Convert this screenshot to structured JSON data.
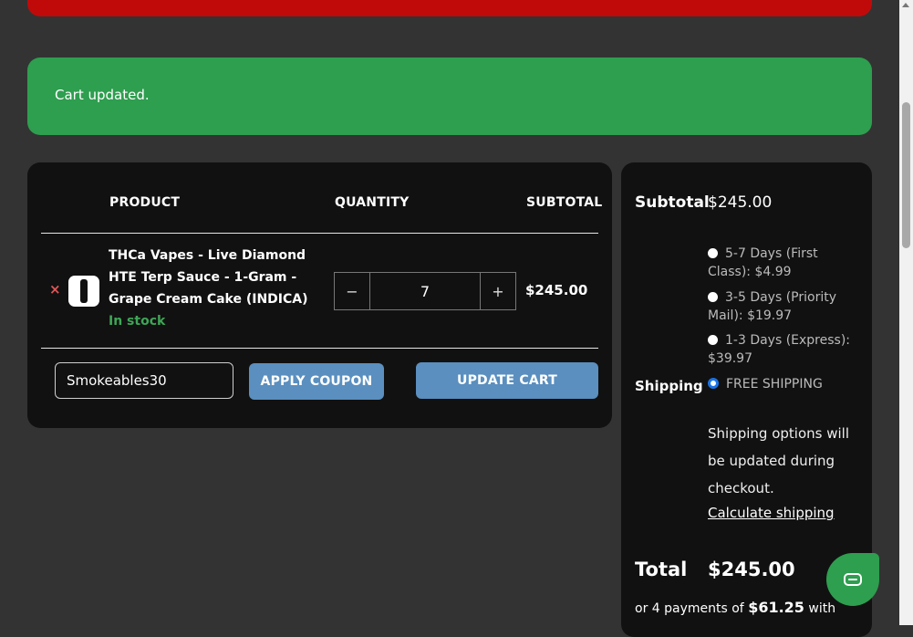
{
  "notice": {
    "text": "Cart updated."
  },
  "cart": {
    "headers": {
      "product": "PRODUCT",
      "quantity": "QUANTITY",
      "subtotal": "SUBTOTAL"
    },
    "item": {
      "remove_icon": "×",
      "name": "THCa Vapes - Live Diamond HTE Terp Sauce - 1-Gram - Grape Cream Cake (INDICA)",
      "stock": "In stock",
      "quantity": "7",
      "minus": "−",
      "plus": "+",
      "subtotal": "$245.00"
    },
    "coupon_value": "Smokeables30",
    "apply_label": "APPLY COUPON",
    "update_label": "UPDATE CART"
  },
  "totals": {
    "subtotal_label": "Subtotal",
    "subtotal_value": "$245.00",
    "shipping_label": "Shipping",
    "shipping_options": [
      {
        "label": "5-7 Days (First Class): $4.99",
        "selected": false
      },
      {
        "label": "3-5 Days (Priority Mail): $19.97",
        "selected": false
      },
      {
        "label": "1-3 Days (Express): $39.97",
        "selected": false
      },
      {
        "label": "FREE SHIPPING",
        "selected": true
      }
    ],
    "shipping_note": "Shipping options will be updated during checkout.",
    "calculate_shipping": "Calculate shipping",
    "total_label": "Total",
    "total_value": "$245.00",
    "installments_prefix": "or 4 payments of",
    "installments_amount": "$61.25",
    "installments_suffix": "with"
  },
  "chat": {
    "icon": "chat-icon"
  },
  "colors": {
    "success": "#2e9e4f",
    "danger": "#c00a0a",
    "button": "#5a8fbf",
    "panel": "#111111"
  }
}
